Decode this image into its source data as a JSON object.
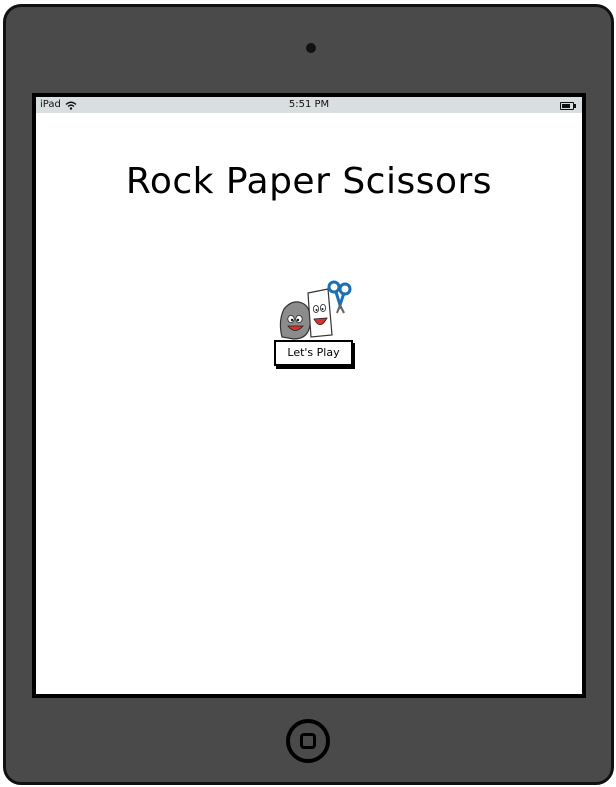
{
  "status_bar": {
    "carrier": "iPad",
    "time": "5:51 PM",
    "wifi_icon": "wifi-icon",
    "battery_icon": "battery-icon"
  },
  "main": {
    "title": "Rock Paper Scissors",
    "mascot_icon": "rock-paper-scissors-characters-icon",
    "play_button_label": "Let's Play"
  },
  "device": {
    "home_button_icon": "home-button-icon",
    "camera_icon": "front-camera-icon"
  },
  "colors": {
    "bezel": "#4a4a4a",
    "status_bar_bg": "#d9dfe1",
    "scissors_blue": "#1a6fb5",
    "tongue_red": "#d8322b"
  }
}
